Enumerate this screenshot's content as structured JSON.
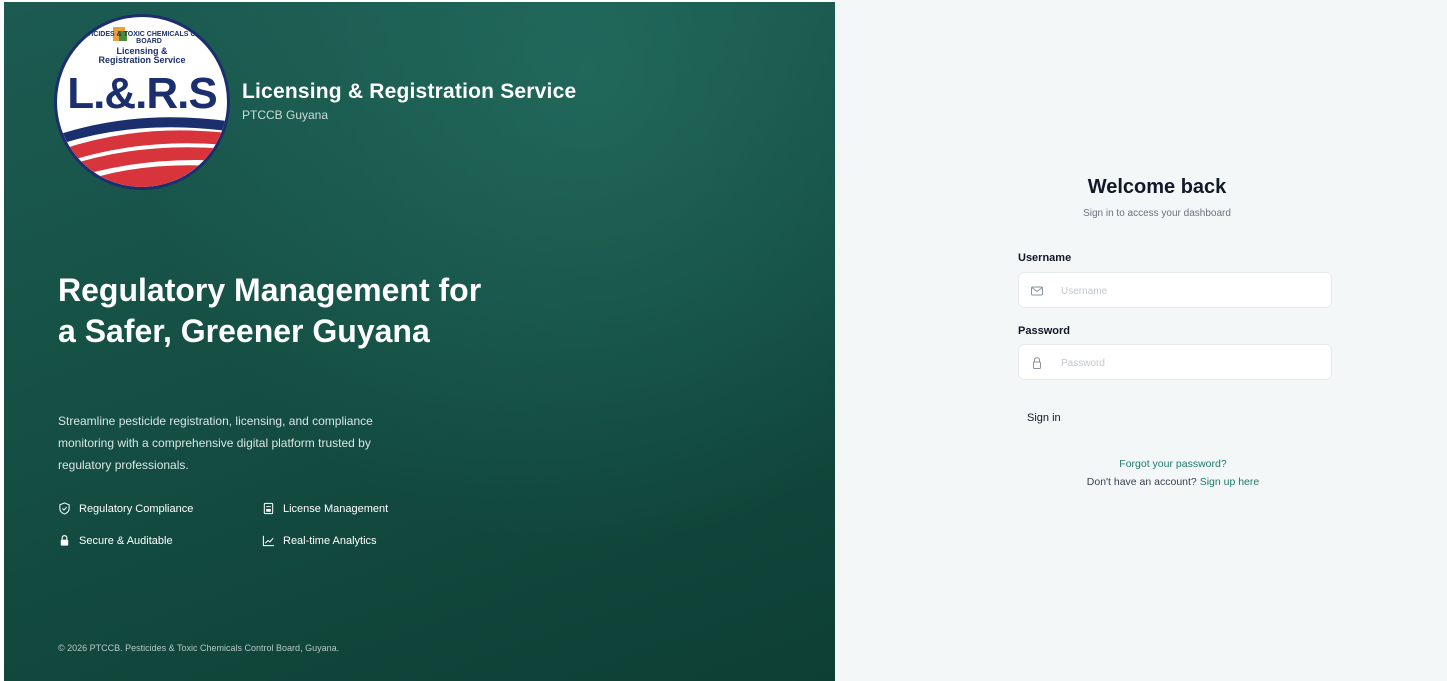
{
  "brand": {
    "title": "Licensing & Registration Service",
    "subtitle": "PTCCB Guyana",
    "logo": {
      "org_text": "PESTICIDES & TOXIC CHEMICALS CONTROL BOARD",
      "tagline_1": "Licensing &",
      "tagline_2": "Registration Service",
      "mark": "L.&.R.S",
      "colors": {
        "navy": "#1b2f6e",
        "red": "#d7343b"
      }
    }
  },
  "hero": {
    "title": "Regulatory Management for a Safer, Greener Guyana",
    "description": "Streamline pesticide registration, licensing, and compliance monitoring with a comprehensive digital platform trusted by regulatory professionals."
  },
  "features": [
    {
      "label": "Regulatory Compliance",
      "icon": "shield-check-icon"
    },
    {
      "label": "License Management",
      "icon": "document-icon"
    },
    {
      "label": "Secure & Auditable",
      "icon": "lock-icon"
    },
    {
      "label": "Real-time Analytics",
      "icon": "trend-chart-icon"
    }
  ],
  "footer": {
    "copyright": "© 2026 PTCCB. Pesticides & Toxic Chemicals Control Board, Guyana."
  },
  "login": {
    "heading": "Welcome back",
    "subheading": "Sign in to access your dashboard",
    "username_label": "Username",
    "username_placeholder": "Username",
    "username_icon": "mail-icon",
    "password_label": "Password",
    "password_placeholder": "Password",
    "password_icon": "lock-icon",
    "signin_label": "Sign in",
    "forgot_label": "Forgot your password?",
    "no_account_text": "Don't have an account?",
    "signup_label": "Sign up here"
  },
  "colors": {
    "panel_dark": "#11473c",
    "panel_light": "#1c5b52",
    "right_bg": "#f3f7f7",
    "link": "#1f7a6f"
  }
}
